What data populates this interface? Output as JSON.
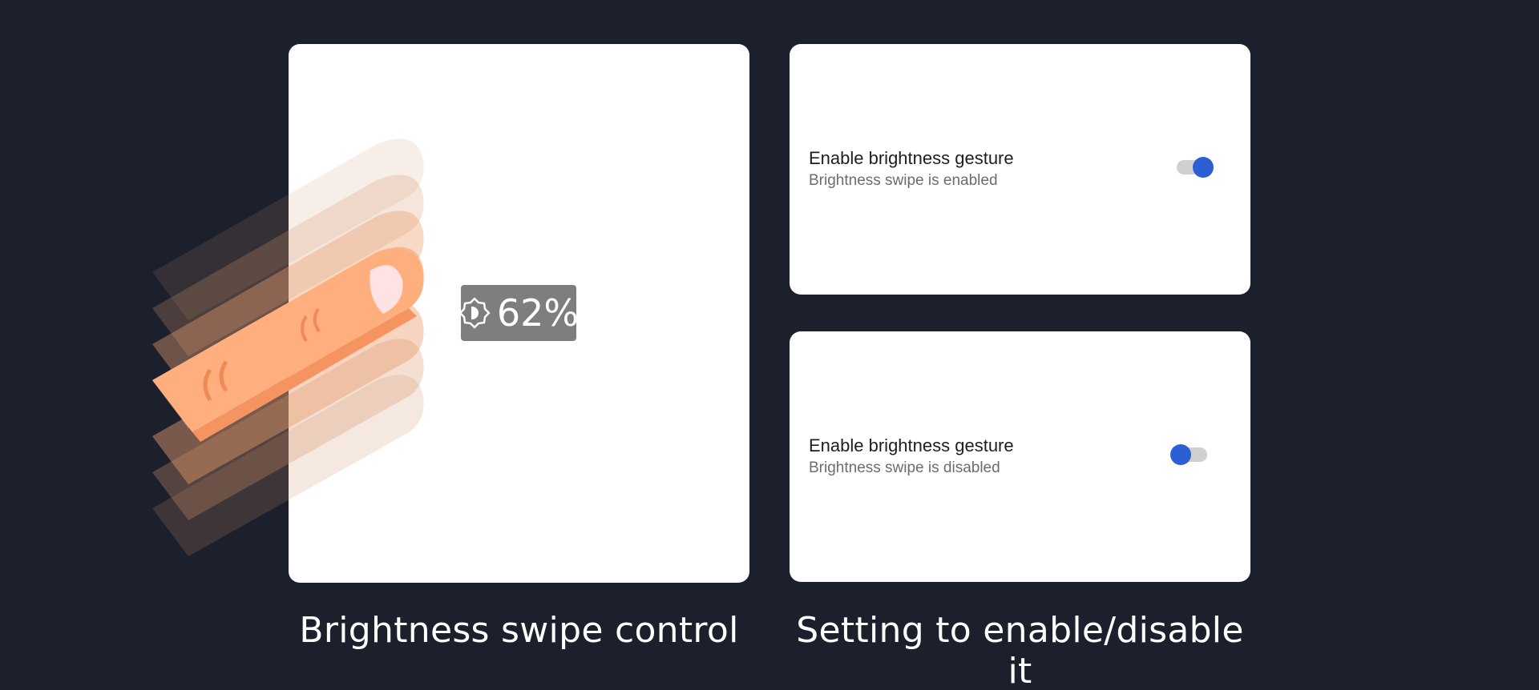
{
  "colors": {
    "background": "#1c202d",
    "card": "#ffffff",
    "accent": "#2b5fd3",
    "indicator_bg": "#7e7e7e",
    "finger": "#ffab78"
  },
  "brightness_demo": {
    "icon": "brightness-icon",
    "value": "62%",
    "level_fraction": 0.62
  },
  "settings": [
    {
      "title": "Enable brightness gesture",
      "subtitle": "Brightness swipe is enabled",
      "toggle_on": true
    },
    {
      "title": "Enable brightness gesture",
      "subtitle": "Brightness swipe is disabled",
      "toggle_on": false
    }
  ],
  "captions": {
    "left": "Brightness swipe control",
    "right": "Setting to enable/disable it"
  }
}
